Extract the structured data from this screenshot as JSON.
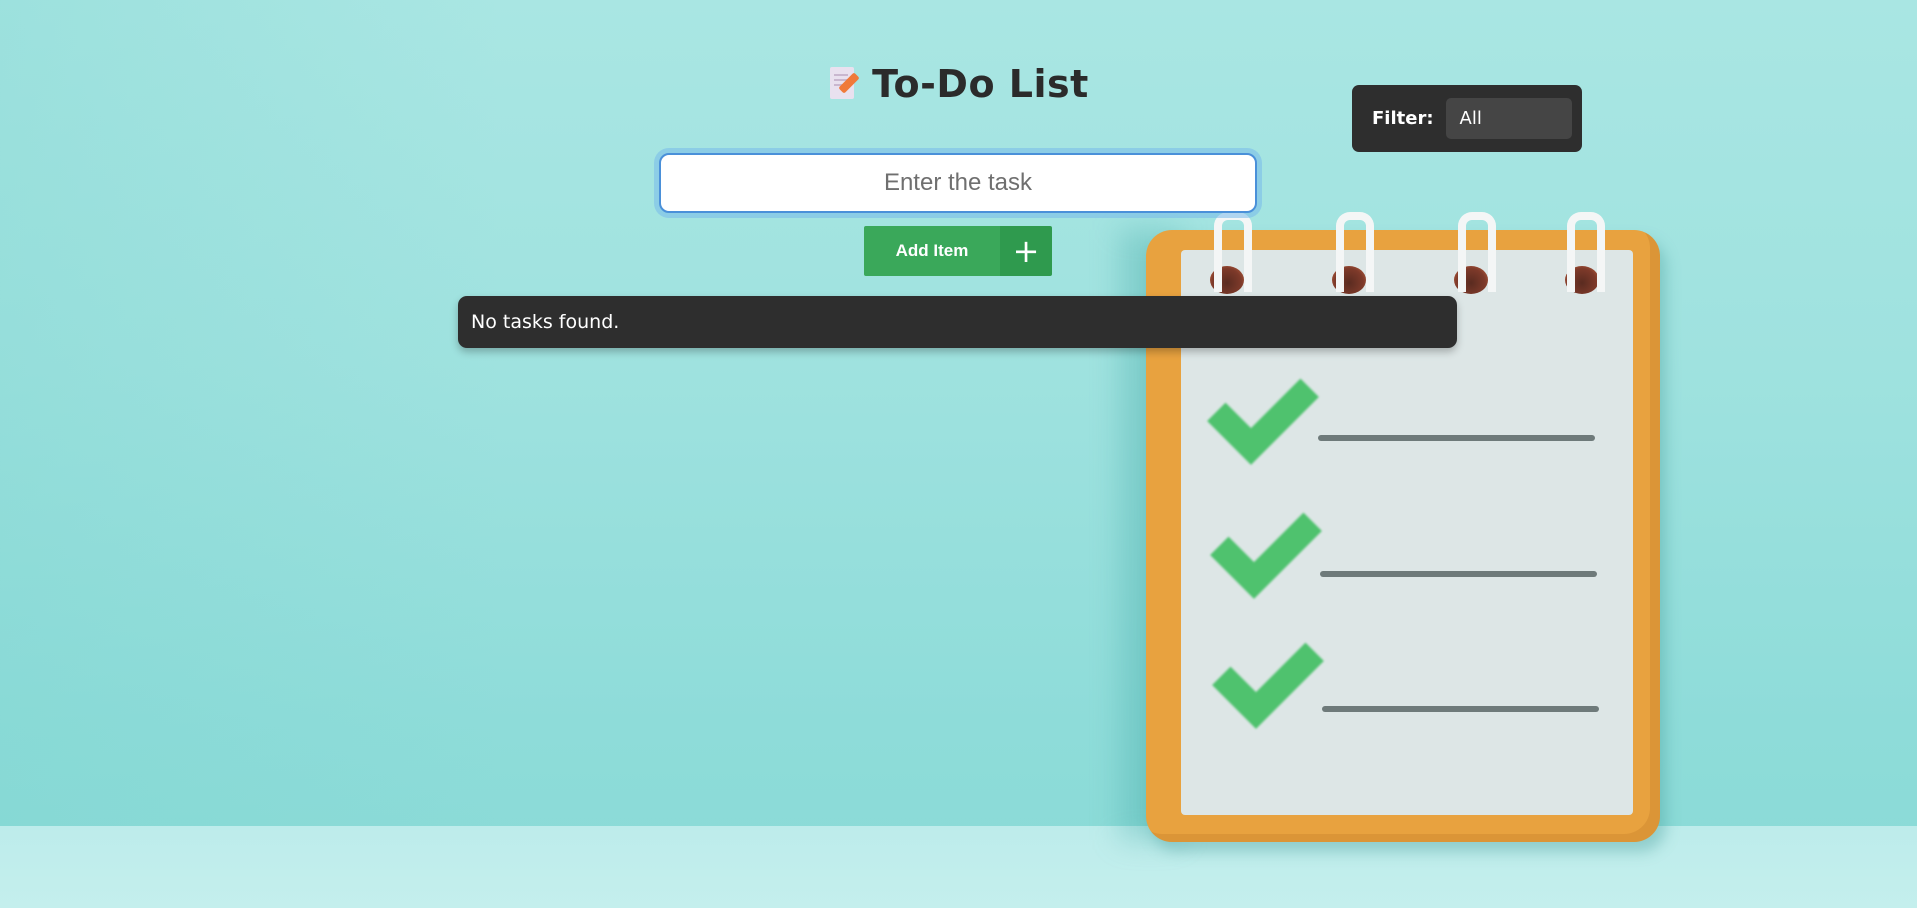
{
  "header": {
    "icon": "memo-icon",
    "title": "To-Do List"
  },
  "filter": {
    "label": "Filter:",
    "selected": "All"
  },
  "task_input": {
    "placeholder": "Enter the task",
    "value": ""
  },
  "add_button": {
    "label": "Add Item",
    "icon": "plus-icon",
    "icon_glyph": "+"
  },
  "task_list": {
    "empty_message": "No tasks found."
  },
  "colors": {
    "background": "#9fe2df",
    "add_button": "#3aa85a",
    "panel_dark": "#2e2e2e",
    "input_focus": "#4a90d9"
  },
  "illustration": {
    "name": "clipboard-checklist-illustration"
  }
}
